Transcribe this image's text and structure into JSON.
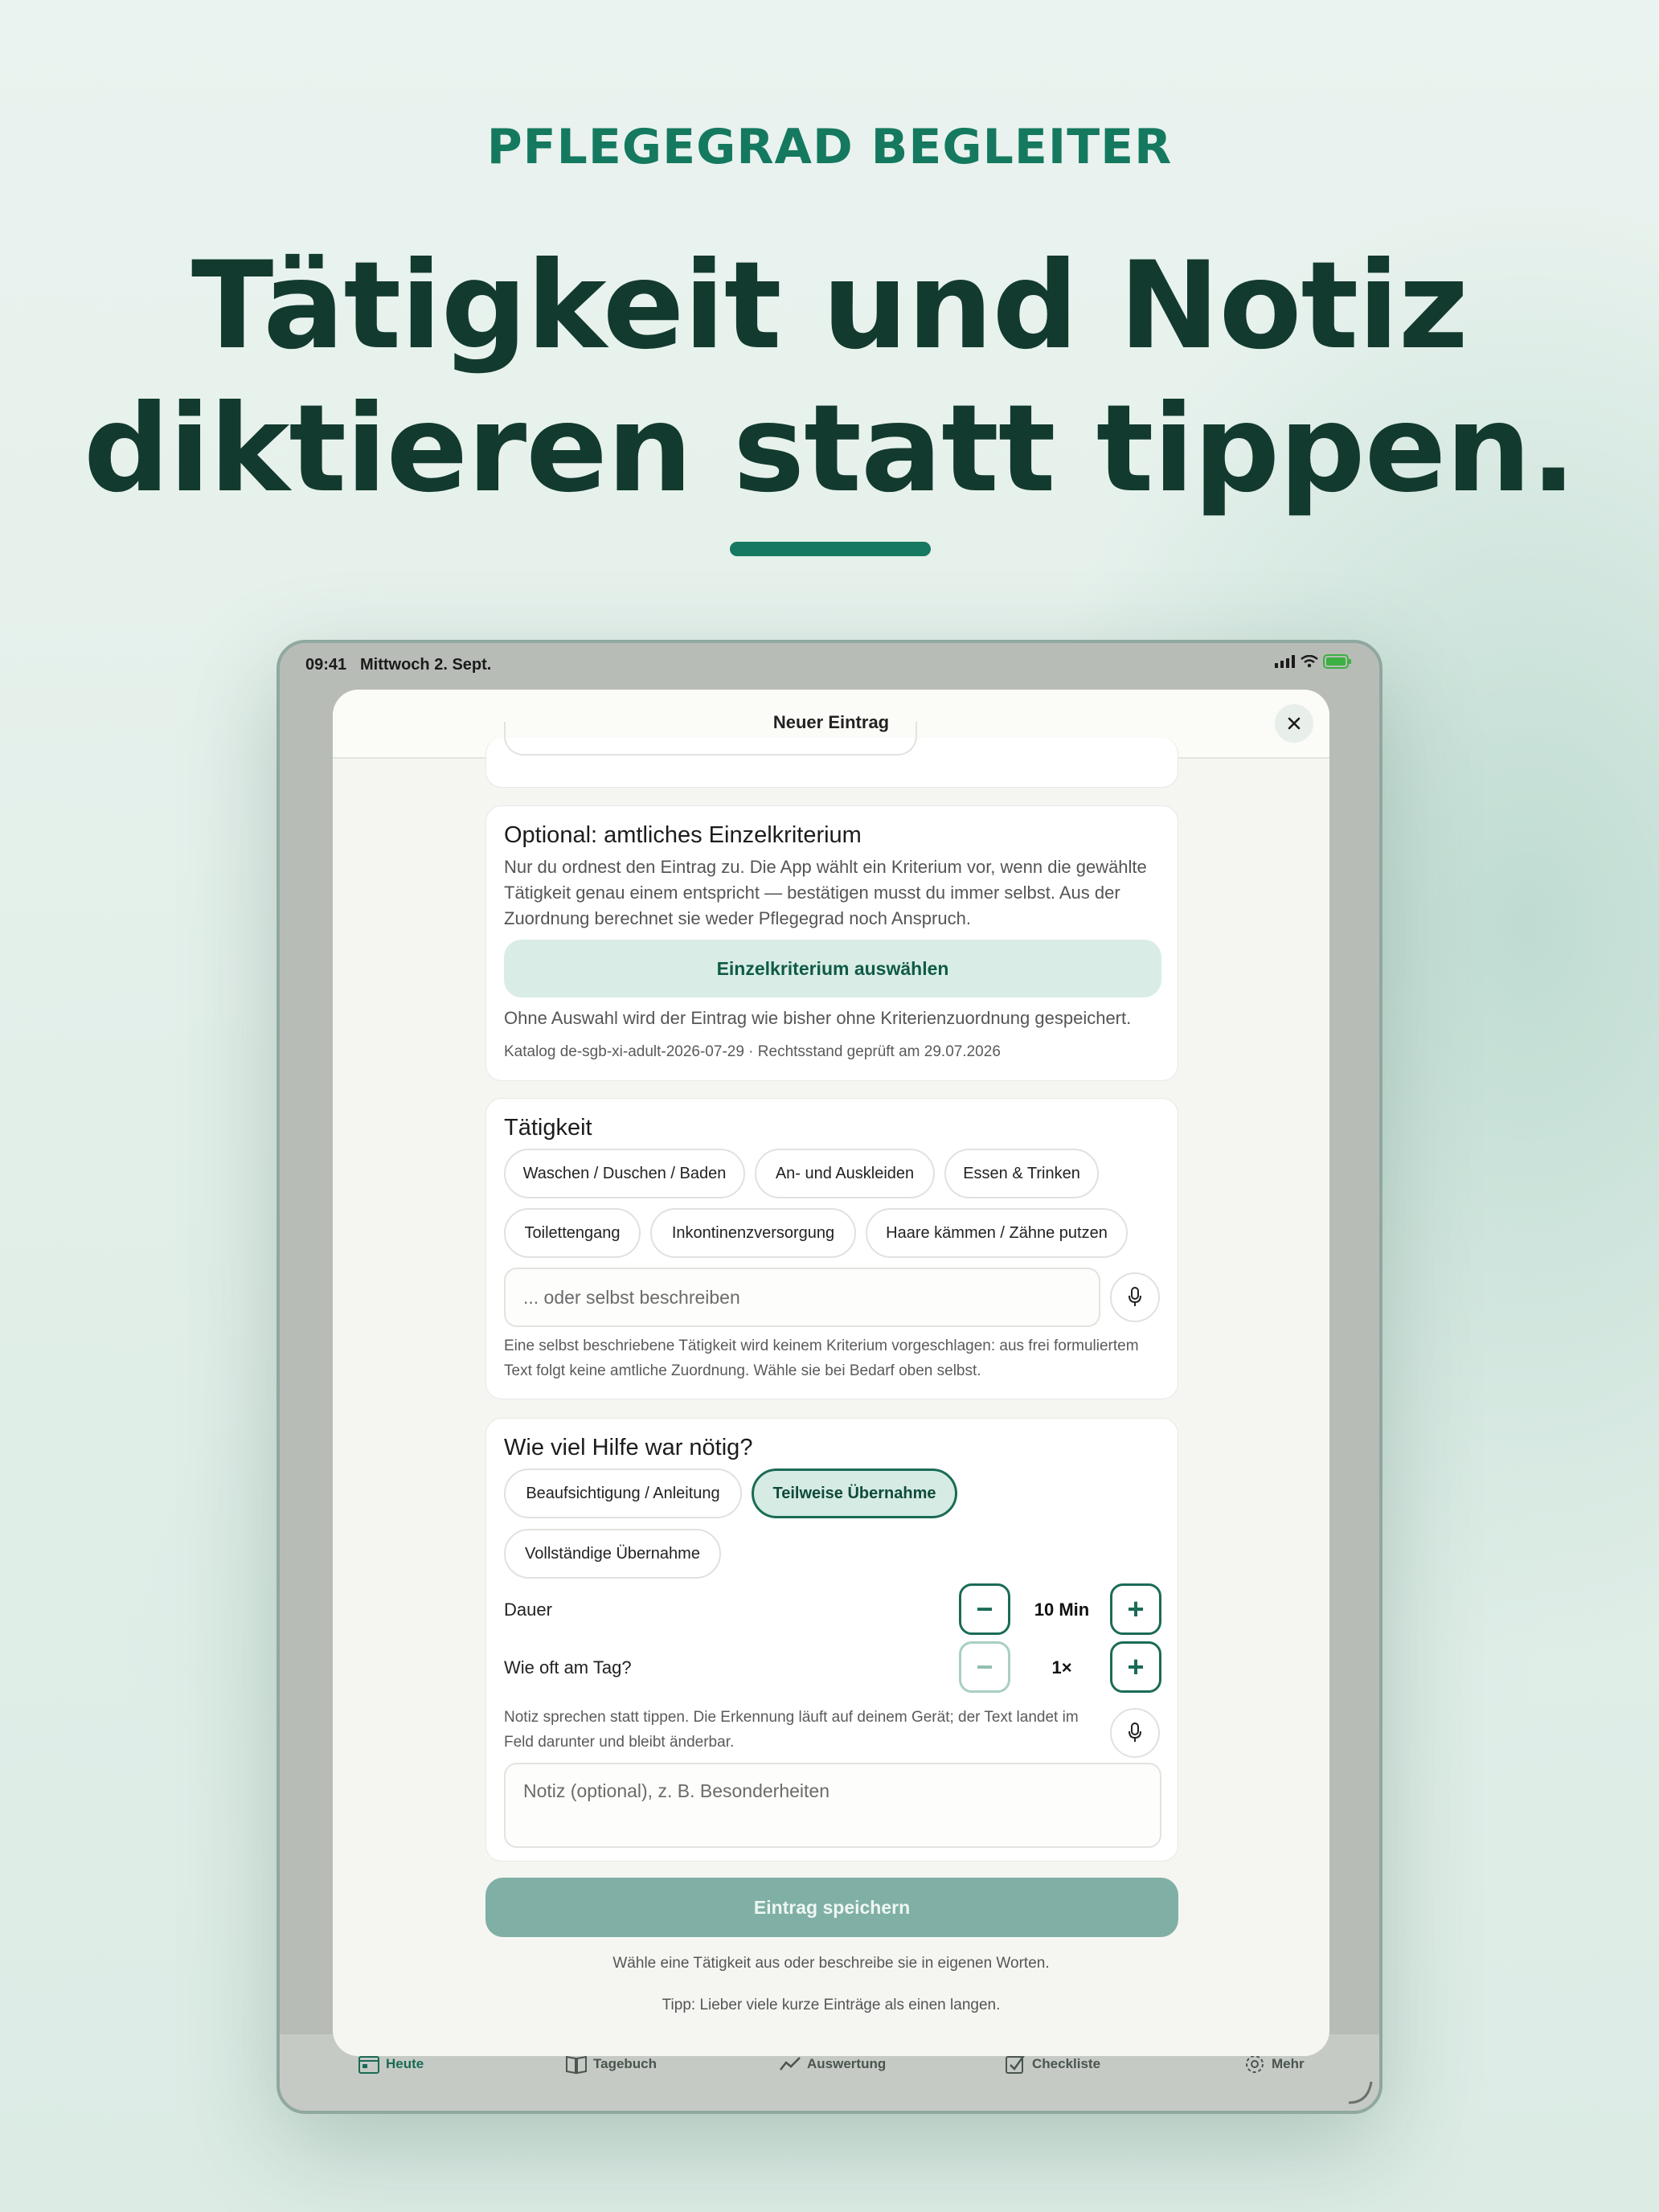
{
  "marketing": {
    "eyebrow": "PFLEGEGRAD BEGLEITER",
    "headline_line1": "Tätigkeit und Notiz",
    "headline_line2": "diktieren statt tippen."
  },
  "status_bar": {
    "time": "09:41",
    "date": "Mittwoch 2. Sept."
  },
  "sheet": {
    "title": "Neuer Eintrag"
  },
  "criterion": {
    "title": "Optional: amtliches Einzelkriterium",
    "description": "Nur du ordnest den Eintrag zu. Die App wählt ein Kriterium vor, wenn die gewählte Tätigkeit genau einem entspricht — bestätigen musst du immer selbst. Aus der Zuordnung berechnet sie weder Pflegegrad noch Anspruch.",
    "button": "Einzelkriterium auswählen",
    "no_selection_note": "Ohne Auswahl wird der Eintrag wie bisher ohne Kriterienzuordnung gespeichert.",
    "catalog": "Katalog de-sgb-xi-adult-2026-07-29 · Rechtsstand geprüft am 29.07.2026"
  },
  "activity": {
    "title": "Tätigkeit",
    "chips": [
      "Waschen / Duschen / Baden",
      "An- und Auskleiden",
      "Essen & Trinken",
      "Toilettengang",
      "Inkontinenzversorgung",
      "Haare kämmen / Zähne putzen"
    ],
    "custom_placeholder": "... oder selbst beschreiben",
    "custom_note": "Eine selbst beschriebene Tätigkeit wird keinem Kriterium vorgeschlagen: aus frei formuliertem Text folgt keine amtliche Zuordnung. Wähle sie bei Bedarf oben selbst."
  },
  "help": {
    "title": "Wie viel Hilfe war nötig?",
    "options": [
      "Beaufsichtigung / Anleitung",
      "Teilweise Übernahme",
      "Vollständige Übernahme"
    ],
    "selected": "Teilweise Übernahme",
    "duration_label": "Dauer",
    "duration_value": "10 Min",
    "frequency_label": "Wie oft am Tag?",
    "frequency_value": "1×",
    "dictation_note": "Notiz sprechen statt tippen. Die Erkennung läuft auf deinem Gerät; der Text landet im Feld darunter und bleibt änderbar.",
    "note_placeholder": "Notiz (optional), z. B. Besonderheiten"
  },
  "save_button": "Eintrag speichern",
  "hint_select": "Wähle eine Tätigkeit aus oder beschreibe sie in eigenen Worten.",
  "hint_tip": "Tipp: Lieber viele kurze Einträge als einen langen.",
  "tabs": [
    "Heute",
    "Tagebuch",
    "Auswertung",
    "Checkliste",
    "Mehr"
  ],
  "colors": {
    "brand": "#14795f",
    "headline": "#133a2e",
    "save_disabled": "#80b0a5",
    "chip_selected_bg": "#d5ebe3"
  }
}
